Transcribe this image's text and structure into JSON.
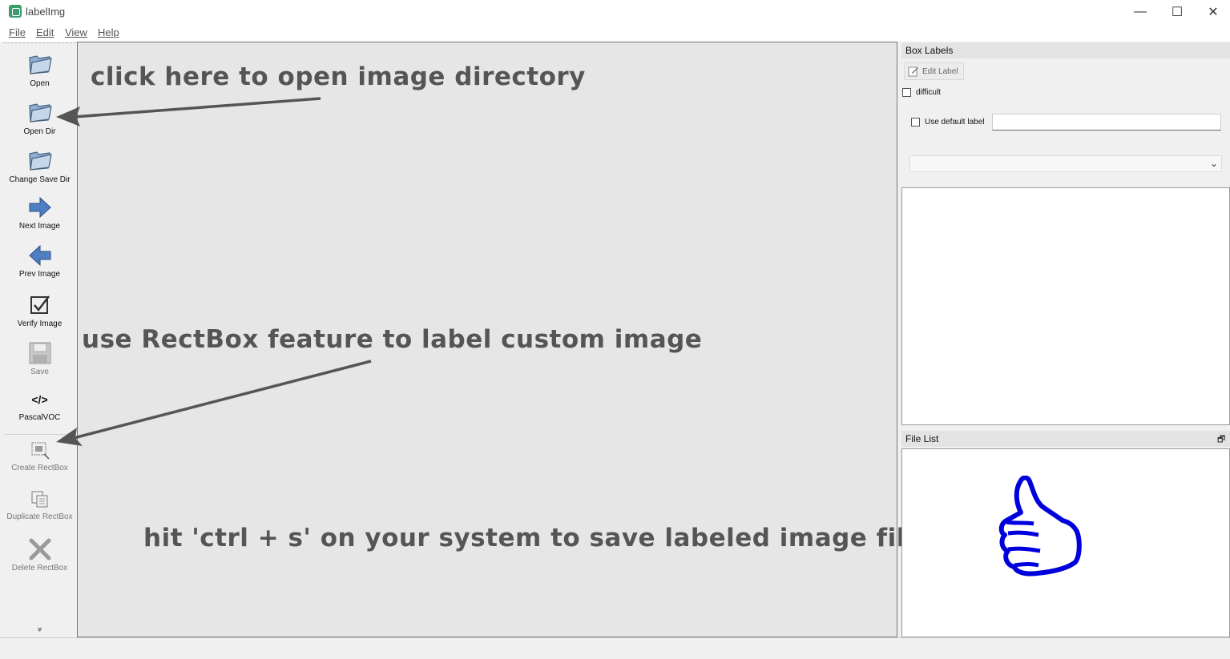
{
  "window": {
    "title": "labelImg",
    "minimize": "—",
    "maximize": "☐",
    "close": "✕"
  },
  "menu": [
    {
      "label": "File"
    },
    {
      "label": "Edit"
    },
    {
      "label": "View"
    },
    {
      "label": "Help"
    }
  ],
  "toolbar": {
    "open": "Open",
    "open_dir": "Open Dir",
    "change_save_dir": "Change Save Dir",
    "next_image": "Next Image",
    "prev_image": "Prev Image",
    "verify_image": "Verify Image",
    "save": "Save",
    "format_icon_text": "</>",
    "format": "PascalVOC",
    "create_rectbox": "Create RectBox",
    "duplicate_rectbox": "Duplicate RectBox",
    "delete_rectbox": "Delete RectBox",
    "expand": "»"
  },
  "annotations": {
    "open_dir_hint": "click here to open image directory",
    "rectbox_hint": "use RectBox feature to label custom image",
    "save_hint": "hit 'ctrl + s'  on your system to save labeled image file (.xml)"
  },
  "box_labels": {
    "title": "Box Labels",
    "edit_label": "Edit Label",
    "difficult": "difficult",
    "use_default_label": "Use default label",
    "default_label_value": "",
    "combo_value": ""
  },
  "file_list": {
    "title": "File List",
    "float_icon": "🗗"
  },
  "colors": {
    "thumb": "#0000dd",
    "arrow": "#555555",
    "annotation_text": "#555555"
  }
}
